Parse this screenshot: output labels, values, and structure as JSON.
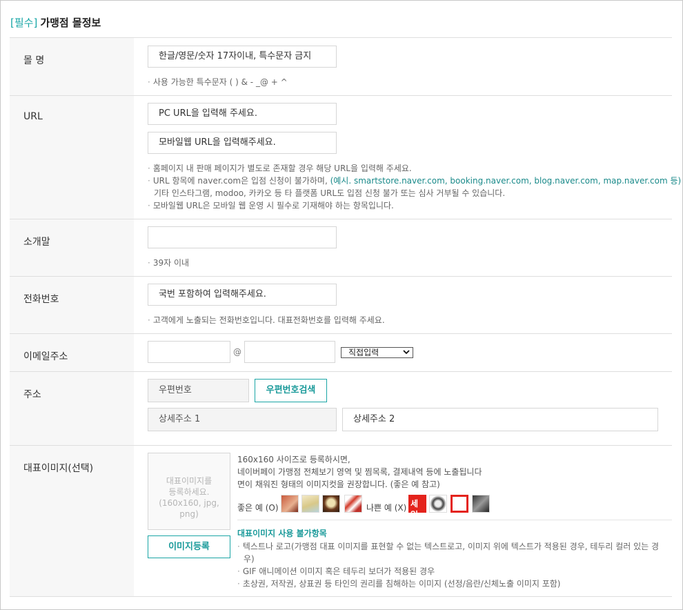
{
  "header": {
    "required_tag": "[필수]",
    "title": "가맹점 몰정보"
  },
  "mall_name": {
    "label": "몰 명",
    "placeholder": "한글/영문/숫자 17자이내, 특수문자 금지",
    "note": "사용 가능한 특수문자 ( ) & - _@ + ^"
  },
  "url": {
    "label": "URL",
    "pc_placeholder": "PC URL을 입력해 주세요.",
    "mobile_placeholder": "모바일웹 URL을 입력해주세요.",
    "notes": {
      "n1": "홈페이지 내 판매 페이지가 별도로 존재할 경우 해당 URL을 입력해 주세요.",
      "n2_prefix": "URL 항목에 naver.com은 입점 신청이 불가하며, ",
      "n2_examples": "(예시. smartstore.naver.com, booking.naver.com, blog.naver.com, map.naver.com 등)",
      "n3": "기타 인스타그램, modoo, 카카오 등 타 플랫폼 URL도 입점 신청 불가 또는 심사 거부될 수 있습니다.",
      "n4": "모바일웹 URL은 모바일 웹 운영 시 필수로 기재해야 하는 항목입니다."
    }
  },
  "intro": {
    "label": "소개말",
    "value": "",
    "note": "39자 이내"
  },
  "phone": {
    "label": "전화번호",
    "placeholder": "국번 포함하여 입력해주세요.",
    "note": "고객에게 노출되는 전화번호입니다. 대표전화번호를 입력해 주세요."
  },
  "email": {
    "label": "이메일주소",
    "local": "",
    "at": "@",
    "domain": "",
    "select_value": "직접입력"
  },
  "address": {
    "label": "주소",
    "zipcode_placeholder": "우편번호",
    "search_button": "우편번호검색",
    "detail1_placeholder": "상세주소 1",
    "detail2_placeholder": "상세주소 2"
  },
  "image": {
    "label": "대표이미지(선택)",
    "placeholder_line1": "대표이미지를",
    "placeholder_line2": "등록하세요.",
    "placeholder_line3": "(160x160, jpg, png)",
    "register_button": "이미지등록",
    "desc1": "160x160 사이즈로 등록하시면,",
    "desc2": "네이버페이 가맹점 전체보기 영역 및 찜목록, 결제내역 등에 노출됩니다",
    "desc3": "면이 채워진 형태의 이미지컷을 권장합니다. (좋은 예 참고)",
    "good_label": "좋은 예 (O)",
    "bad_label": "나쁜 예 (X)",
    "sale_badge": "세일",
    "restriction_title": "대표이미지 사용 불가항목",
    "r1a": "텍스트나 로고(가맹점 대표 이미지를 표현할 수 없는 텍스트로고, 이미지 위에 텍스트가 적용된 경우, 테두리 컬러 있는 경",
    "r1b": "우)",
    "r2": "GIF 애니메이션 이미지 혹은 테두리 보더가 적용된 경우",
    "r3": "초상권, 저작권, 상표권 등 타인의 권리를 침해하는 이미지 (선정/음란/신체노출 이미지 포함)"
  },
  "colors": {
    "accent": "#1aa5a5",
    "label_bg": "#f7f7f7",
    "border": "#dedede"
  }
}
